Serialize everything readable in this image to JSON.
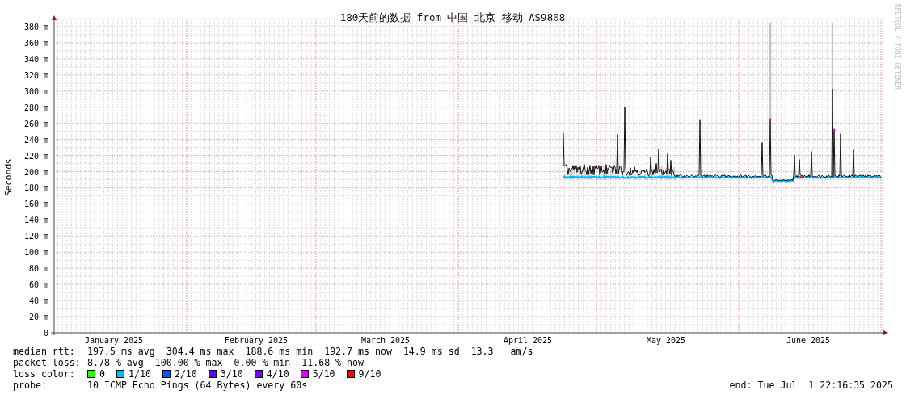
{
  "title": "180天前的数据 from 中国 北京 移动 AS9808",
  "y_axis_title": "Seconds",
  "y_ticks": [
    "380 m",
    "360 m",
    "340 m",
    "320 m",
    "300 m",
    "280 m",
    "260 m",
    "240 m",
    "220 m",
    "200 m",
    "180 m",
    "160 m",
    "140 m",
    "120 m",
    "100 m",
    "80 m",
    "60 m",
    "40 m",
    "20 m",
    "0"
  ],
  "months": [
    "January 2025",
    "February 2025",
    "March 2025",
    "April 2025",
    "May 2025",
    "June 2025"
  ],
  "stamp": "RRDTOOL / TOBI OETIKER",
  "stats": [
    {
      "label": "median rtt:",
      "value": "197.5 ms avg  304.4 ms max  188.6 ms min  192.7 ms now  14.9 ms sd  13.3   am/s"
    },
    {
      "label": "packet loss:",
      "value": "8.78 % avg  100.00 % max  0.00 % min  11.68 % now"
    }
  ],
  "loss_colors": {
    "label": "loss color:",
    "items": [
      {
        "label": "0",
        "color": "#26ff00"
      },
      {
        "label": "1/10",
        "color": "#00b8ff"
      },
      {
        "label": "2/10",
        "color": "#0059ff"
      },
      {
        "label": "3/10",
        "color": "#5e00ff"
      },
      {
        "label": "4/10",
        "color": "#7e00ff"
      },
      {
        "label": "5/10",
        "color": "#dd00ff"
      },
      {
        "label": "9/10",
        "color": "#ff0000"
      }
    ]
  },
  "probe": {
    "label": "probe:",
    "value": "10 ICMP Echo Pings (64 Bytes) every 60s"
  },
  "end": "end: Tue Jul  1 22:16:35 2025"
}
